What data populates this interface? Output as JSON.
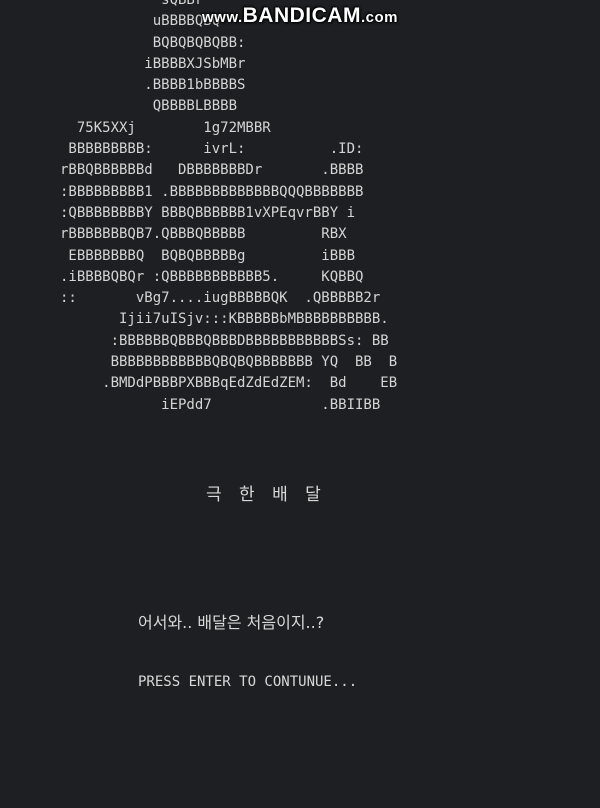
{
  "watermark": {
    "prefix": "www.",
    "brand": "BANDICAM",
    "suffix": ".com"
  },
  "ascii_art": "            sQBBr\n           uBBBBQBQ\n           BQBQBQBQBB:\n          iBBBBXJSbMBr\n          .BBBB1bBBBBS\n           QBBBBLBBBB\n  75K5XXj        1g72MBBR\n BBBBBBBBB:      ivrL:          .ID:\nrBBQBBBBBBd   DBBBBBBBDr       .BBBB\n:BBBBBBBBB1 .BBBBBBBBBBBBBQQQBBBBBBB\n:QBBBBBBBBY BBBQBBBBBB1vXPEqvrBBY i\nrBBBBBBBQB7.QBBBQBBBBB         RBX\n EBBBBBBBQ  BQBQBBBBBg         iBBB\n.iBBBBQBQr :QBBBBBBBBBBB5.     KQBBQ\n::       vBg7....iugBBBBBQK  .QBBBBB2r\n       Ijii7uISjv:::KBBBBBbMBBBBBBBBBB.\n      :BBBBBBQBBBQBBBDBBBBBBBBBBBSs: BB\n      BBBBBBBBBBBBQBQBQBBBBBBB YQ  BB  B\n     .BMDdPBBBPXBBBqEdZdEdZEM:  Bd    EB\n            iEPdd7             .BBIIBB",
  "title": "극 한 배 달",
  "greeting": "어서와.. 배달은 처음이지..?",
  "prompt": "PRESS ENTER TO CONTUNUE..."
}
